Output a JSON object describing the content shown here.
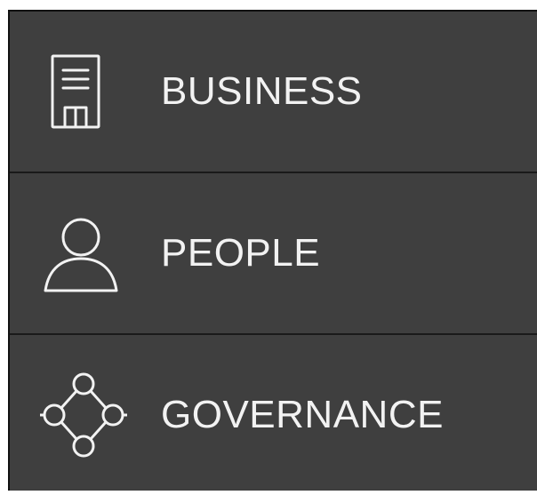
{
  "menu": {
    "items": [
      {
        "label": "BUSINESS",
        "icon": "building-icon"
      },
      {
        "label": "PEOPLE",
        "icon": "person-icon"
      },
      {
        "label": "GOVERNANCE",
        "icon": "network-icon"
      }
    ]
  },
  "colors": {
    "background": "#3f3f3f",
    "divider": "#1a1a1a",
    "text": "#f2f2f2",
    "icon_stroke": "#f2f2f2"
  }
}
